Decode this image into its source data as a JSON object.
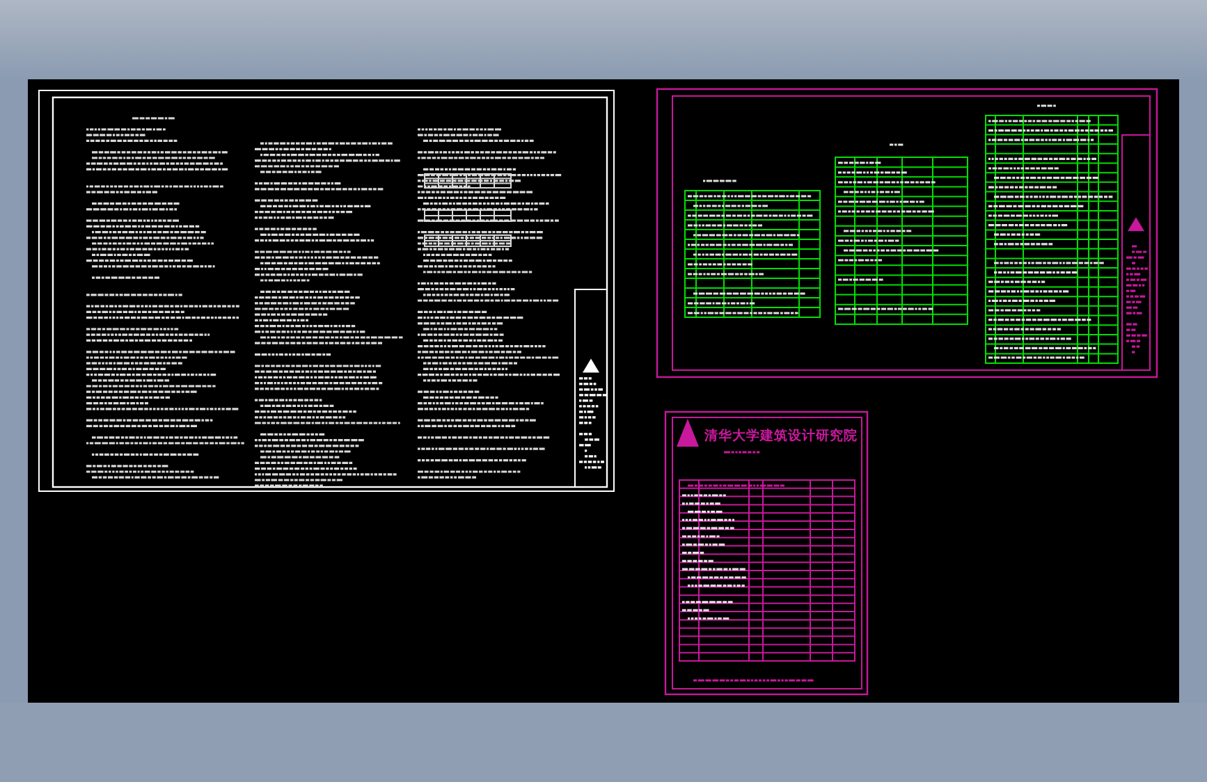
{
  "viewport": {
    "sheets": [
      {
        "kind": "notes",
        "color": "#ffffff"
      },
      {
        "kind": "legend",
        "color": "#c8189c"
      },
      {
        "kind": "index",
        "color": "#c8189c",
        "title": "清华大学建筑设计研究院"
      }
    ]
  }
}
